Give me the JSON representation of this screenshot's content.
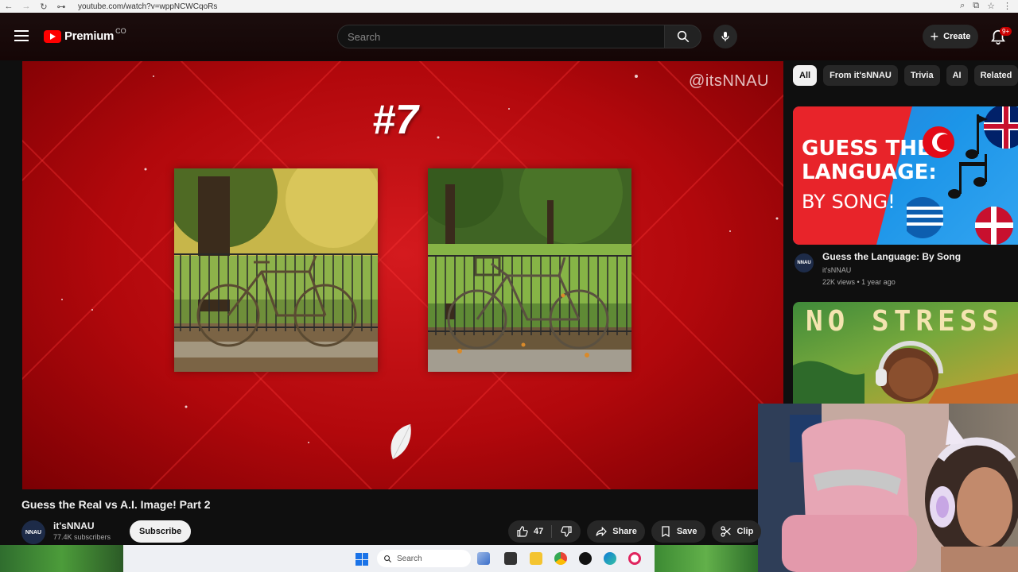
{
  "browser": {
    "url": "youtube.com/watch?v=wppNCWCqoRs"
  },
  "header": {
    "logo_text": "Premium",
    "logo_sup": "CO",
    "search_placeholder": "Search",
    "create_label": "Create",
    "notification_count": "9+"
  },
  "player": {
    "watermark": "@itsNNAU",
    "question_number": "#7"
  },
  "video": {
    "title": "Guess the Real vs A.I. Image! Part 2",
    "channel": "it'sNNAU",
    "subscribers": "77.4K subscribers",
    "subscribe_label": "Subscribe",
    "like_count": "47",
    "share_label": "Share",
    "save_label": "Save",
    "clip_label": "Clip"
  },
  "sidebar": {
    "chips": [
      {
        "label": "All",
        "active": true
      },
      {
        "label": "From it'sNNAU",
        "active": false
      },
      {
        "label": "Trivia",
        "active": false
      },
      {
        "label": "AI",
        "active": false
      },
      {
        "label": "Related",
        "active": false
      }
    ],
    "videos": [
      {
        "thumb_lines": [
          "GUESS THE",
          "LANGUAGE:",
          "BY SONG!"
        ],
        "title": "Guess the Language: By Song",
        "channel": "it'sNNAU",
        "meta": "22K views • 1 year ago",
        "avatar_text": "NNAU"
      },
      {
        "thumb_text": "NO STRESS LOF"
      }
    ]
  },
  "taskbar": {
    "search_label": "Search"
  },
  "colors": {
    "youtube_red": "#ff0000",
    "player_red": "#c4101a",
    "background": "#0f0f0f"
  }
}
